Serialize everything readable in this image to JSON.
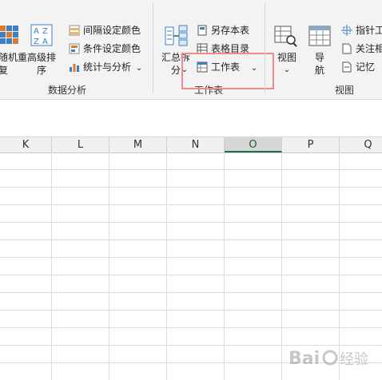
{
  "ribbon": {
    "sort_group": {
      "btn_left_label": "随机重\n复",
      "btn_left_arrow": "⌄",
      "advanced_sort_label": "高级排\n序",
      "advanced_sort_arrow": "⌄",
      "interval_color": "间隔设定颜色",
      "condition_color": "条件设定颜色",
      "stats_analysis": "统计与分析",
      "stats_arrow": "⌄",
      "group_label": "数据分析"
    },
    "worksheet_group": {
      "summary_split_label": "汇总拆\n分",
      "summary_split_arrow": "⌄",
      "save_as_sheet": "另存本表",
      "table_directory": "表格目录",
      "worksheet": "工作表",
      "worksheet_arrow": "⌄",
      "group_label": "工作表"
    },
    "view_group": {
      "view_label": "视图",
      "view_arrow": "⌄",
      "nav_label": "导\n航",
      "pointer_tool": "指针工",
      "focus": "关注相",
      "memory": "记忆",
      "group_label": "视图"
    }
  },
  "columns": [
    {
      "label": "K",
      "selected": false
    },
    {
      "label": "L",
      "selected": false
    },
    {
      "label": "M",
      "selected": false
    },
    {
      "label": "N",
      "selected": false
    },
    {
      "label": "O",
      "selected": true
    },
    {
      "label": "P",
      "selected": false
    },
    {
      "label": "Q",
      "selected": false
    }
  ],
  "colors": {
    "accent": "#1e7145",
    "highlight_box": "#f08a8a"
  },
  "watermark": {
    "text": "Bai 经验"
  }
}
